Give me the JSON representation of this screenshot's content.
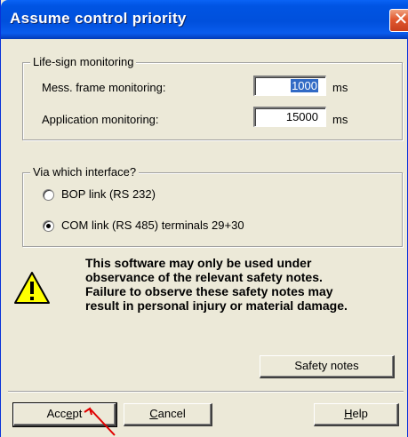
{
  "window": {
    "title": "Assume control priority",
    "close_label": "✕"
  },
  "lifesign": {
    "legend": "Life-sign monitoring",
    "mess_label": "Mess. frame monitoring:",
    "mess_value": "1000",
    "mess_unit": "ms",
    "app_label": "Application monitoring:",
    "app_value": "15000",
    "app_unit": "ms"
  },
  "interface": {
    "legend": "Via which interface?",
    "options": [
      {
        "label": "BOP link (RS 232)",
        "selected": false
      },
      {
        "label": "COM link (RS 485) terminals 29+30",
        "selected": true
      }
    ]
  },
  "warning": {
    "icon": "warning-icon",
    "lines": [
      "This software may only be used under",
      "observance of the relevant safety notes.",
      "Failure to observe these safety notes may",
      "result in personal injury or material damage."
    ]
  },
  "buttons": {
    "safety": "Safety notes",
    "accept_prefix": "Acc",
    "accept_mnemonic": "e",
    "accept_suffix": "pt",
    "cancel_mnemonic": "C",
    "cancel_suffix": "ancel",
    "help_mnemonic": "H",
    "help_suffix": "elp"
  },
  "colors": {
    "titlebar": "#0054e3",
    "dialog_bg": "#ece9d8",
    "selection": "#316ac5",
    "annotation_arrow": "#e00000"
  }
}
